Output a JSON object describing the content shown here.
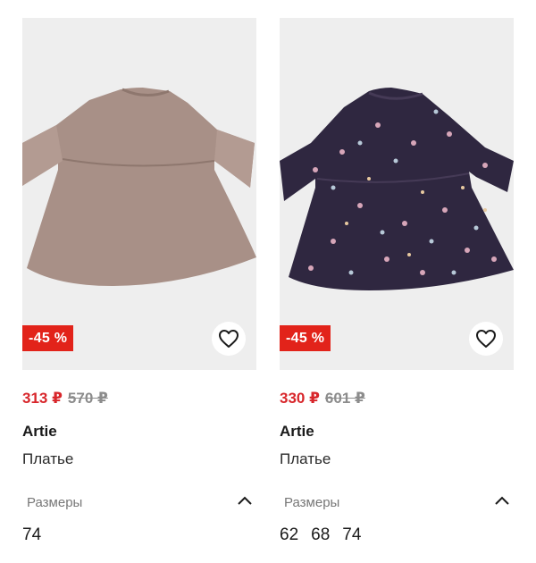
{
  "products": [
    {
      "discount": "-45 %",
      "price": "313 ₽",
      "old_price": "570 ₽",
      "brand": "Artie",
      "kind": "Платье",
      "sizes_label": "Размеры",
      "sizes": [
        "74"
      ],
      "image_icon": "dress-photo",
      "dress_color": "#a89087"
    },
    {
      "discount": "-45 %",
      "price": "330 ₽",
      "old_price": "601 ₽",
      "brand": "Artie",
      "kind": "Платье",
      "sizes_label": "Размеры",
      "sizes": [
        "62",
        "68",
        "74"
      ],
      "image_icon": "dress-photo",
      "dress_color": "#2f2740"
    }
  ],
  "colors": {
    "sale_red": "#e2231a",
    "price_red": "#d8262b",
    "old_price_grey": "#8c8c8c"
  }
}
